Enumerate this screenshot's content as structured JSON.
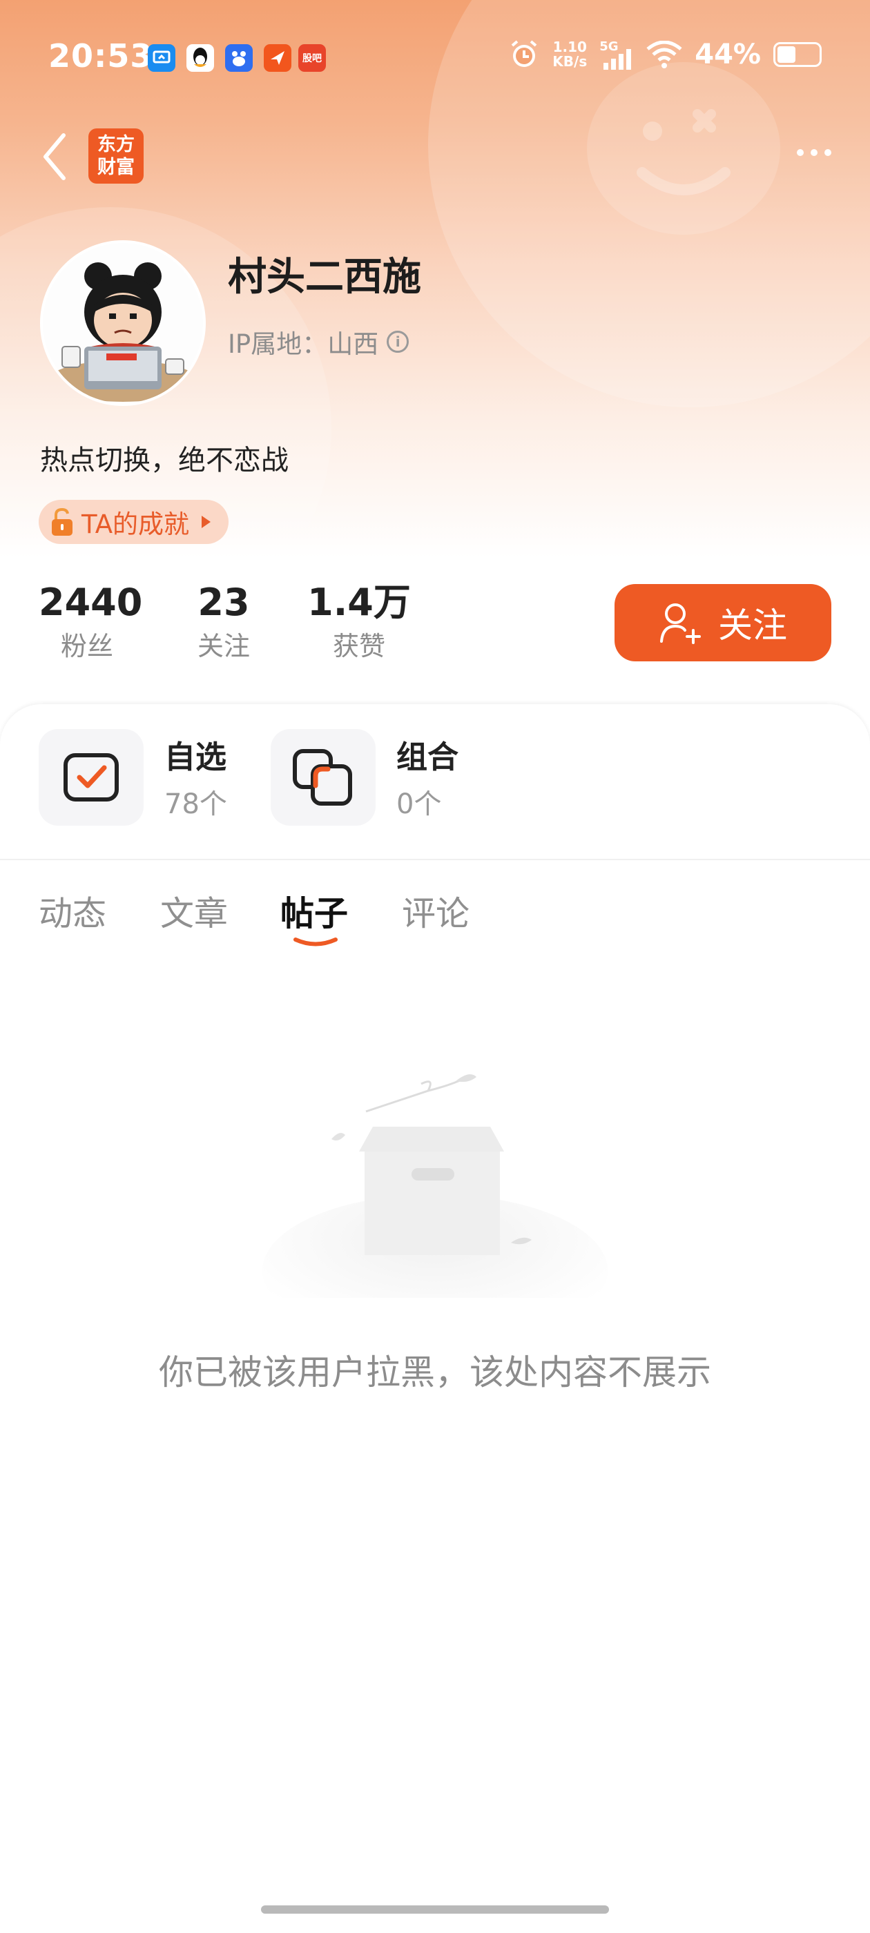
{
  "status_bar": {
    "time": "20:53",
    "notification_icons": [
      "screen-cast-icon",
      "qq-icon",
      "baidu-icon",
      "share-app-icon",
      "stock-app-icon"
    ],
    "stock_app_label": "股吧",
    "net_speed_value": "1.10",
    "net_speed_unit": "KB/s",
    "network": "5G",
    "battery": "44%",
    "battery_level": 0.44
  },
  "nav": {
    "logo_line1": "东方",
    "logo_line2": "财富"
  },
  "profile": {
    "name": "村头二西施",
    "ip_location": "IP属地：山西",
    "bio": "热点切换，绝不恋战",
    "achievement_label": "TA的成就"
  },
  "stats": [
    {
      "value": "2440",
      "label": "粉丝"
    },
    {
      "value": "23",
      "label": "关注"
    },
    {
      "value": "1.4万",
      "label": "获赞"
    }
  ],
  "follow_button": {
    "label": "关注"
  },
  "features": [
    {
      "title": "自选",
      "count": "78个",
      "icon": "watchlist-icon"
    },
    {
      "title": "组合",
      "count": "0个",
      "icon": "portfolio-icon"
    }
  ],
  "tabs": [
    {
      "label": "动态",
      "active": false
    },
    {
      "label": "文章",
      "active": false
    },
    {
      "label": "帖子",
      "active": true
    },
    {
      "label": "评论",
      "active": false
    }
  ],
  "empty_state": {
    "message": "你已被该用户拉黑，该处内容不展示"
  },
  "colors": {
    "accent": "#ee5a24",
    "header_gradient_top": "#f3a172",
    "muted_text": "#8c8c8c"
  }
}
